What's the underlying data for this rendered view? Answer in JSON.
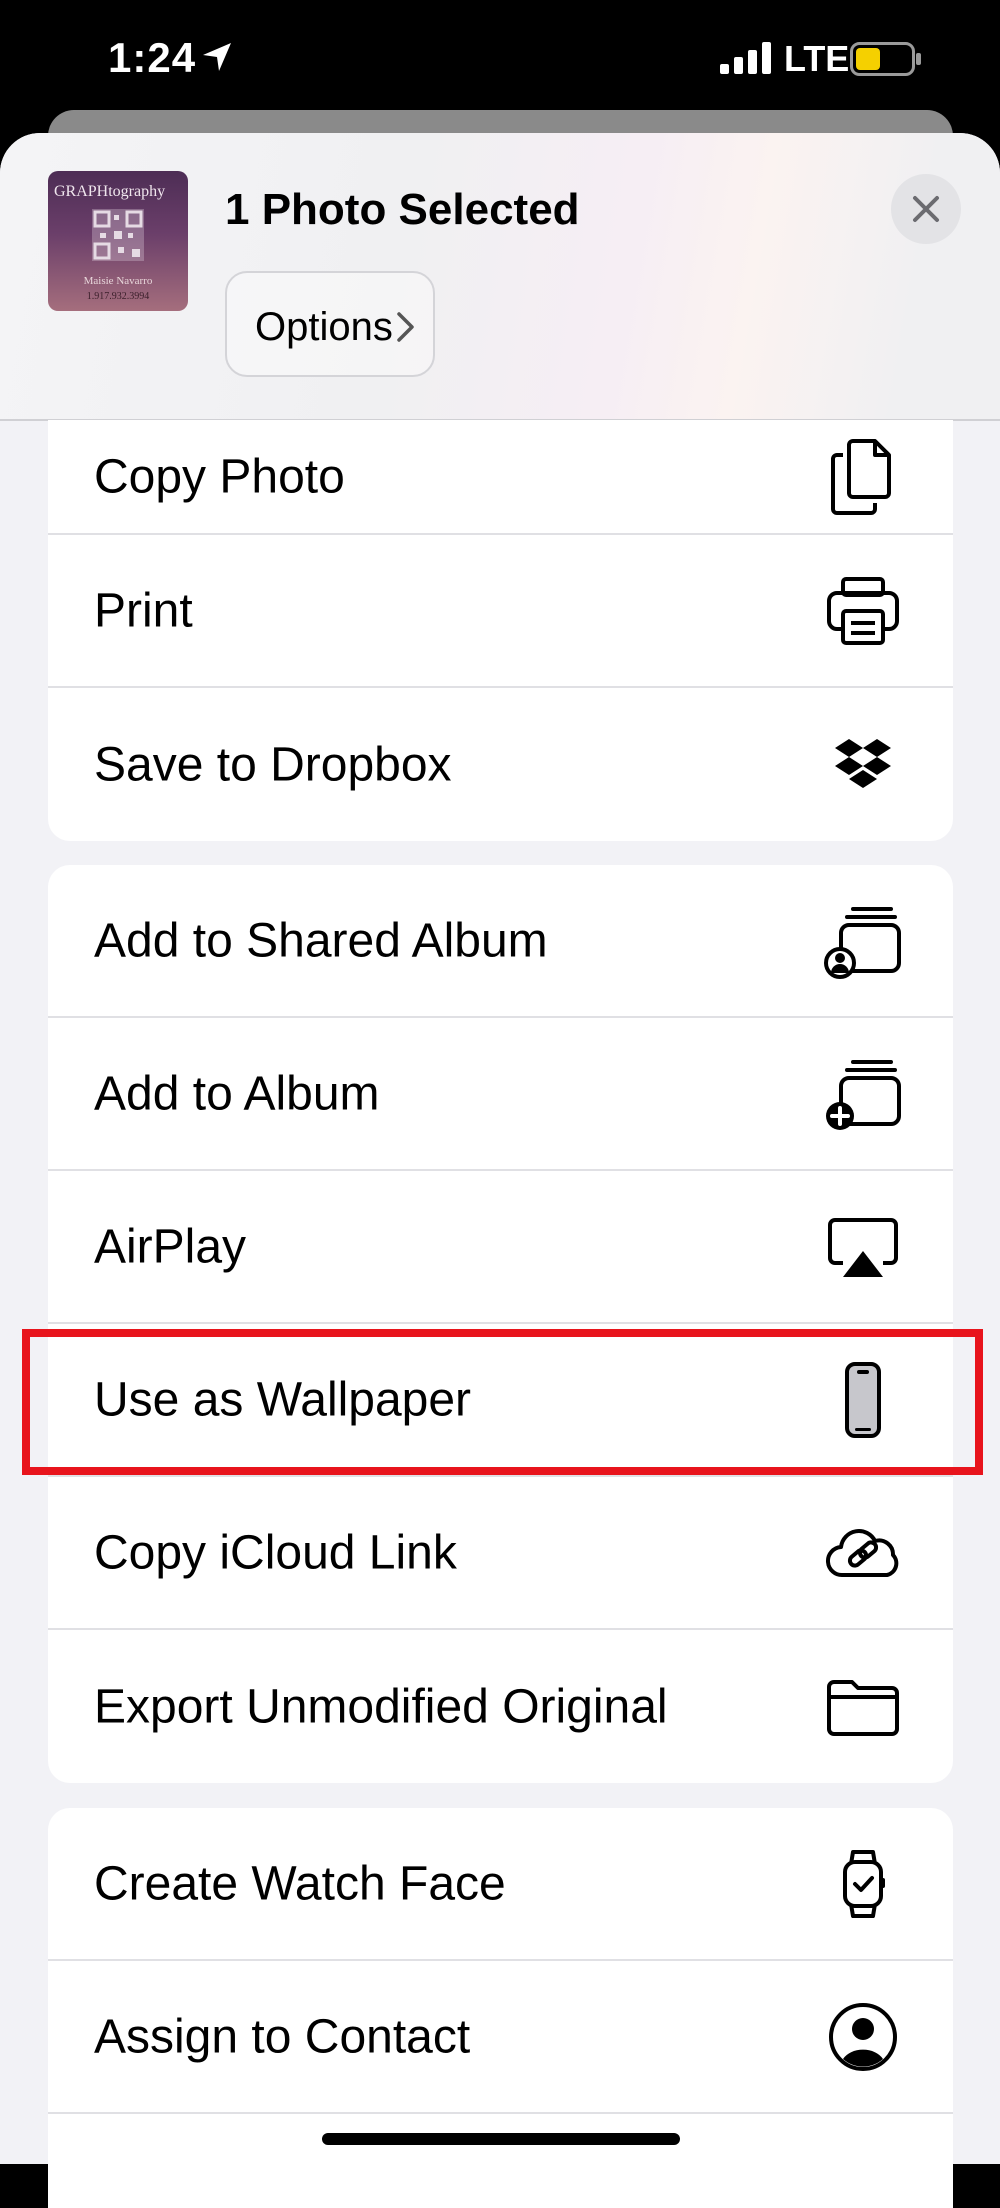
{
  "status_bar": {
    "time": "1:24",
    "network": "LTE",
    "battery_color": "#f5d000"
  },
  "header": {
    "title": "1 Photo Selected",
    "options_label": "Options",
    "thumbnail": {
      "title": "GRAPHtography",
      "name": "Maisie Navarro",
      "phone": "1.917.932.3994"
    }
  },
  "groups": [
    {
      "items": [
        {
          "label": "Copy Photo",
          "icon": "copy-photo-icon"
        },
        {
          "label": "Print",
          "icon": "printer-icon"
        },
        {
          "label": "Save to Dropbox",
          "icon": "dropbox-icon"
        }
      ]
    },
    {
      "items": [
        {
          "label": "Add to Shared Album",
          "icon": "shared-album-icon"
        },
        {
          "label": "Add to Album",
          "icon": "add-album-icon"
        },
        {
          "label": "AirPlay",
          "icon": "airplay-icon"
        },
        {
          "label": "Use as Wallpaper",
          "icon": "wallpaper-phone-icon",
          "highlighted": true
        },
        {
          "label": "Copy iCloud Link",
          "icon": "icloud-link-icon"
        },
        {
          "label": "Export Unmodified Original",
          "icon": "folder-icon"
        }
      ]
    },
    {
      "items": [
        {
          "label": "Create Watch Face",
          "icon": "watch-icon"
        },
        {
          "label": "Assign to Contact",
          "icon": "contact-icon"
        }
      ]
    }
  ],
  "highlight_color": "#e8141c"
}
